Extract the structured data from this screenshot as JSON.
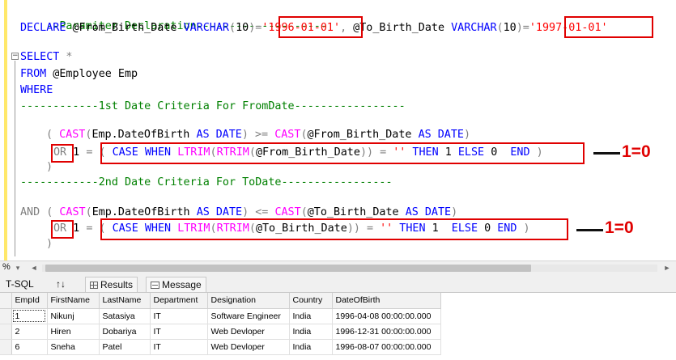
{
  "editor": {
    "lines": {
      "l1_comment": "--Paramiter Declaration--------------------",
      "l2_declare": "DECLARE",
      "l2_var1": " @From_Birth_Date ",
      "l2_type1": "VARCHAR",
      "l2_p1": "(",
      "l2_n1": "10",
      "l2_p2": ")=",
      "l2_val1": "'1996-01-01'",
      "l2_comma": ",",
      "l2_var2": " @To_Birth_Date ",
      "l2_type2": "VARCHAR",
      "l2_p3": "(",
      "l2_n2": "10",
      "l2_p4": ")=",
      "l2_val2": "'1997-01-01'",
      "l3_select": "SELECT",
      "l3_star": " *",
      "l4_from": "FROM",
      "l4_rest": " @Employee Emp",
      "l5_where": "WHERE",
      "l6_comment": "------------1st Date Criteria For FromDate-----------------",
      "l7_paren": "( ",
      "l7_cast1": "CAST",
      "l7_p1": "(",
      "l7_col": "Emp.DateOfBirth ",
      "l7_as1": "AS",
      "l7_date1": " DATE",
      "l7_p2": ") >= ",
      "l7_cast2": "CAST",
      "l7_p3": "(",
      "l7_var": "@From_Birth_Date ",
      "l7_as2": "AS",
      "l7_date2": " DATE",
      "l7_p4": ")",
      "l8_or": "OR",
      "l8_one": " 1 ",
      "l8_eq": "= ",
      "l8_p1": "( ",
      "l8_case": "CASE WHEN ",
      "l8_ltrim": "LTRIM",
      "l8_p2": "(",
      "l8_rtrim": "RTRIM",
      "l8_p3": "(",
      "l8_var": "@From_Birth_Date",
      "l8_p4": ")) = ",
      "l8_empty": "''",
      "l8_then": " THEN ",
      "l8_n1": "1",
      "l8_else": " ELSE ",
      "l8_n0": "0",
      "l8_end": "  END ",
      "l8_p5": ")",
      "l9_close": ")",
      "l10_comment": "------------2nd Date Criteria For ToDate-----------------",
      "l11_and": "AND",
      "l11_paren": " ( ",
      "l11_cast1": "CAST",
      "l11_p1": "(",
      "l11_col": "Emp.DateOfBirth ",
      "l11_as1": "AS",
      "l11_date1": " DATE",
      "l11_p2": ") <= ",
      "l11_cast2": "CAST",
      "l11_p3": "(",
      "l11_var": "@To_Birth_Date ",
      "l11_as2": "AS",
      "l11_date2": " DATE",
      "l11_p4": ")",
      "l12_or": "OR",
      "l12_one": " 1 ",
      "l12_eq": "= ",
      "l12_p1": "( ",
      "l12_case": "CASE WHEN ",
      "l12_ltrim": "LTRIM",
      "l12_p2": "(",
      "l12_rtrim": "RTRIM",
      "l12_p3": "(",
      "l12_var": "@To_Birth_Date",
      "l12_p4": ")) = ",
      "l12_empty": "''",
      "l12_then": " THEN ",
      "l12_n1": "1",
      "l12_else": "  ELSE ",
      "l12_n0": "0",
      "l12_end": " END ",
      "l12_p5": ")",
      "l13_close": ")"
    },
    "fold_symbol": "−"
  },
  "annotations": {
    "first": "1=0",
    "second": "1=0"
  },
  "zoom_bar": {
    "zoom": "%",
    "decrease": "◄",
    "increase": "►"
  },
  "tabs": {
    "tsql": "T-SQL",
    "sort": "↑↓",
    "results": "Results",
    "messages": "Message"
  },
  "results": {
    "columns": [
      "EmpId",
      "FirstName",
      "LastName",
      "Department",
      "Designation",
      "Country",
      "DateOfBirth"
    ],
    "rows": [
      [
        "1",
        "Nikunj",
        "Satasiya",
        "IT",
        "Software Engineer",
        "India",
        "1996-04-08 00:00:00.000"
      ],
      [
        "2",
        "Hiren",
        "Dobariya",
        "IT",
        "Web Devloper",
        "India",
        "1996-12-31 00:00:00.000"
      ],
      [
        "6",
        "Sneha",
        "Patel",
        "IT",
        "Web Devloper",
        "India",
        "1996-08-07 00:00:00.000"
      ]
    ]
  },
  "colors": {
    "keyword": "#0000ff",
    "function": "#ff00ff",
    "comment": "#008000",
    "string": "#ff0000",
    "operator": "#808080",
    "highlight_box": "#e00000"
  }
}
